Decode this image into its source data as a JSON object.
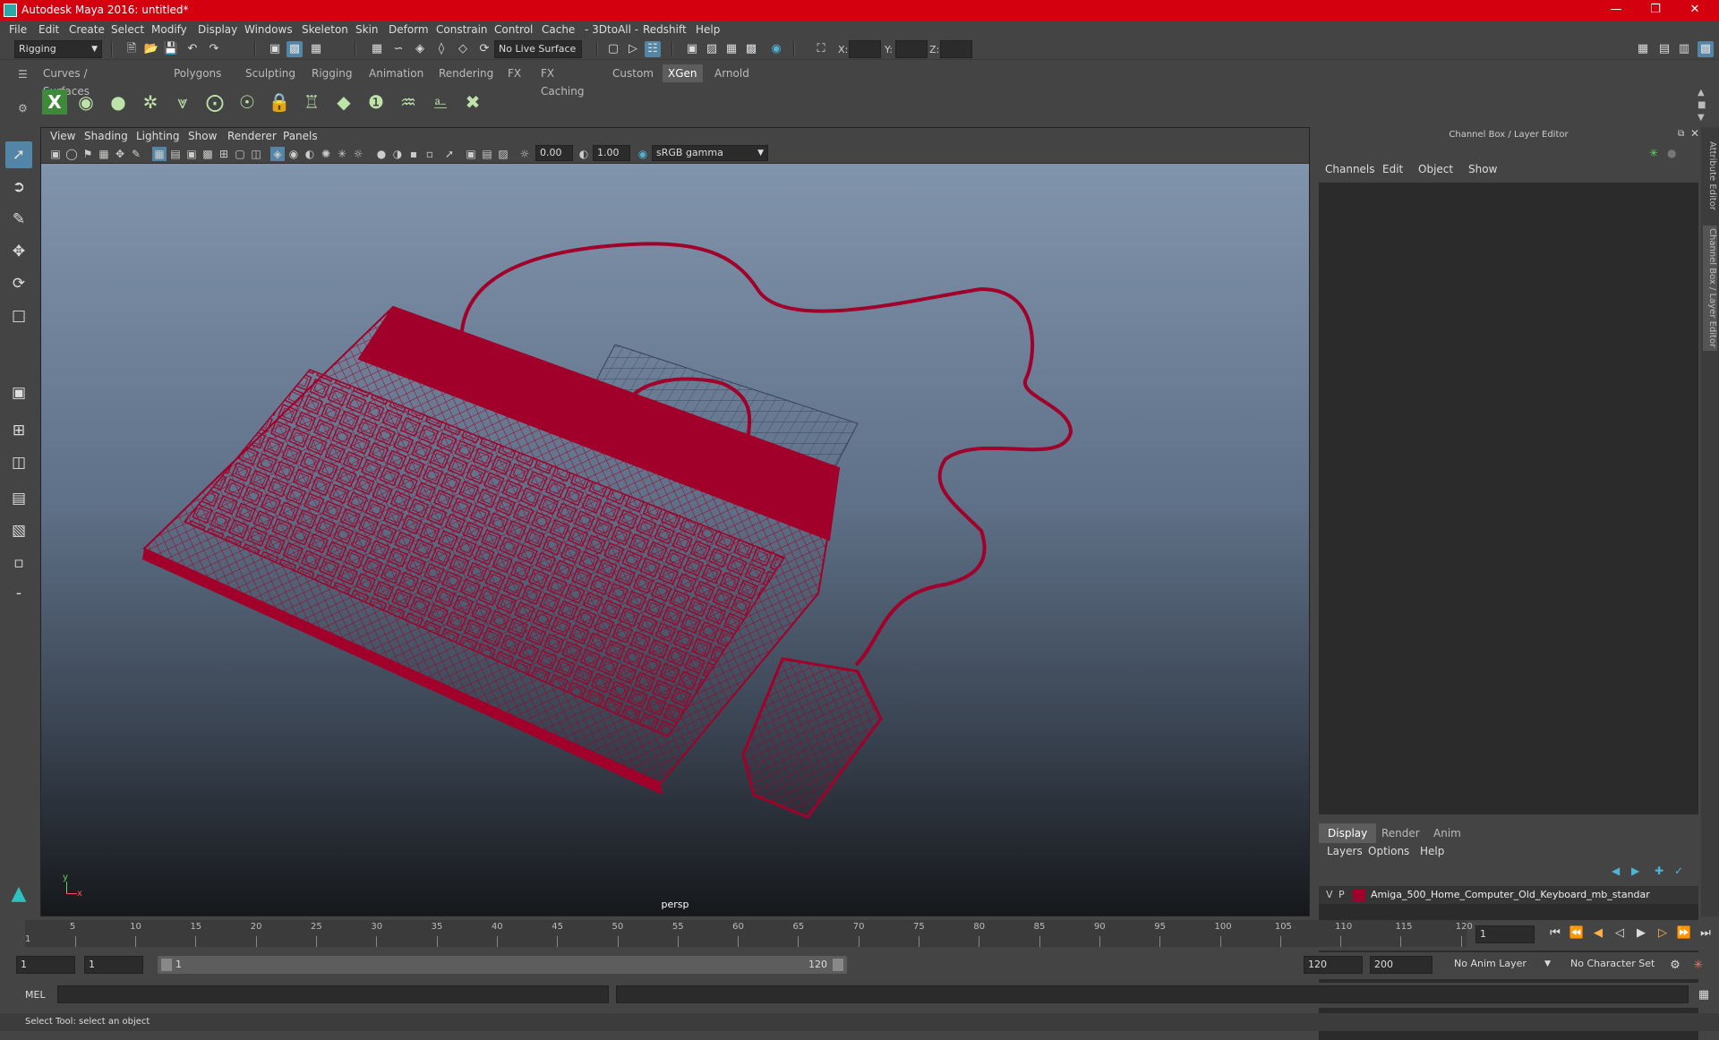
{
  "window": {
    "title": "Autodesk Maya 2016: untitled*"
  },
  "menubar": [
    "File",
    "Edit",
    "Create",
    "Select",
    "Modify",
    "Display",
    "Windows",
    "Skeleton",
    "Skin",
    "Deform",
    "Constrain",
    "Control",
    "Cache",
    "- 3DtoAll -",
    "Redshift",
    "Help"
  ],
  "statusline": {
    "mode": "Rigging",
    "live_surface": "No Live Surface",
    "x_label": "X:",
    "y_label": "Y:",
    "z_label": "Z:"
  },
  "shelf": {
    "tabs": [
      "Curves / Surfaces",
      "Polygons",
      "Sculpting",
      "Rigging",
      "Animation",
      "Rendering",
      "FX",
      "FX Caching",
      "Custom",
      "XGen",
      "Arnold"
    ],
    "active_tab": "XGen"
  },
  "viewport": {
    "menu": [
      "View",
      "Shading",
      "Lighting",
      "Show",
      "Renderer",
      "Panels"
    ],
    "exposure": "0.00",
    "gamma": "1.00",
    "colorspace": "sRGB gamma",
    "camera_label": "persp",
    "axis_y": "y",
    "axis_x": "x",
    "wire_color": "#a0002a"
  },
  "channelbox": {
    "title": "Channel Box / Layer Editor",
    "menu": [
      "Channels",
      "Edit",
      "Object",
      "Show"
    ]
  },
  "layereditor": {
    "tabs": [
      "Display",
      "Render",
      "Anim"
    ],
    "active_tab": "Display",
    "menu": [
      "Layers",
      "Options",
      "Help"
    ],
    "layer": {
      "v": "V",
      "p": "P",
      "name": "Amiga_500_Home_Computer_Old_Keyboard_mb_standar",
      "color": "#a0002a"
    }
  },
  "sidetabs": [
    "Attribute Editor",
    "Channel Box / Layer Editor"
  ],
  "timeslider": {
    "ticks": [
      "5",
      "10",
      "15",
      "20",
      "25",
      "30",
      "35",
      "40",
      "45",
      "50",
      "55",
      "60",
      "65",
      "70",
      "75",
      "80",
      "85",
      "90",
      "95",
      "100",
      "105",
      "110",
      "115",
      "120"
    ],
    "start_marker": "1",
    "current_frame": "1"
  },
  "rangeslider": {
    "start": "1",
    "playback_start": "1",
    "range_start": "1",
    "range_end": "120",
    "playback_end": "120",
    "end": "200",
    "anim_layer": "No Anim Layer",
    "character_set": "No Character Set"
  },
  "cmdline": {
    "label": "MEL"
  },
  "helpline": {
    "text": "Select Tool: select an object"
  }
}
